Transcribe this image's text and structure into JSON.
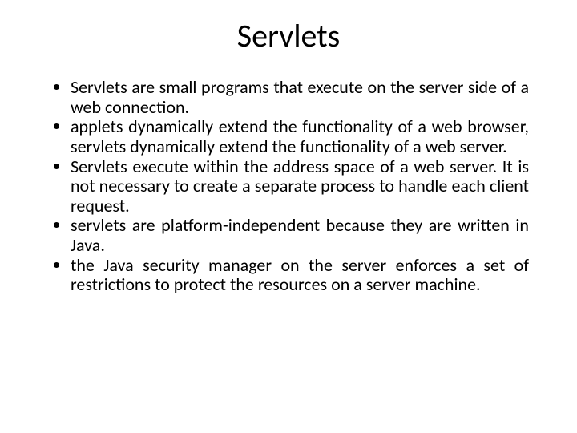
{
  "title": "Servlets",
  "bullets": [
    "Servlets are small programs that execute on the server side of a web connection.",
    "applets dynamically extend the functionality of a web browser, servlets dynamically extend the functionality of a web server.",
    "Servlets execute within the address space of a web server. It is not necessary to create a separate process to handle each client request.",
    "servlets are platform-independent because they are written in Java.",
    "the Java security manager on the server enforces a set of restrictions to protect the resources on a server machine."
  ]
}
